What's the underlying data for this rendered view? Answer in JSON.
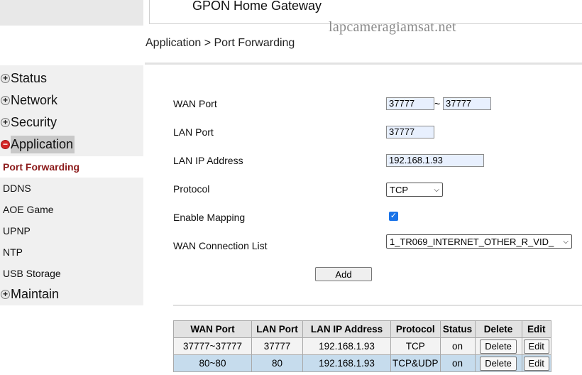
{
  "header": {
    "title": "GPON Home Gateway",
    "watermark": "lapcameragiamsat.net"
  },
  "breadcrumb": "Application > Port Forwarding",
  "sidebar": {
    "groups": [
      {
        "label": "Status",
        "expanded": false
      },
      {
        "label": "Network",
        "expanded": false
      },
      {
        "label": "Security",
        "expanded": false
      },
      {
        "label": "Application",
        "expanded": true
      },
      {
        "label": "Maintain",
        "expanded": false
      }
    ],
    "sub_items": [
      "Port Forwarding",
      "DDNS",
      "AOE Game",
      "UPNP",
      "NTP",
      "USB Storage"
    ],
    "selected": "Port Forwarding"
  },
  "form": {
    "wan_port_label": "WAN Port",
    "wan_port_start": "37777",
    "tilde": "~",
    "wan_port_end": "37777",
    "lan_port_label": "LAN Port",
    "lan_port": "37777",
    "lan_ip_label": "LAN IP Address",
    "lan_ip": "192.168.1.93",
    "protocol_label": "Protocol",
    "protocol": "TCP",
    "enable_mapping_label": "Enable Mapping",
    "enable_mapping": true,
    "wan_conn_label": "WAN Connection List",
    "wan_conn": "1_TR069_INTERNET_OTHER_R_VID_",
    "add_label": "Add"
  },
  "table": {
    "headers": [
      "WAN Port",
      "LAN Port",
      "LAN IP Address",
      "Protocol",
      "Status",
      "Delete",
      "Edit"
    ],
    "rows": [
      {
        "wan_port": "37777~37777",
        "lan_port": "37777",
        "lan_ip": "192.168.1.93",
        "protocol": "TCP",
        "status": "on",
        "delete": "Delete",
        "edit": "Edit"
      },
      {
        "wan_port": "80~80",
        "lan_port": "80",
        "lan_ip": "192.168.1.93",
        "protocol": "TCP&UDP",
        "status": "on",
        "delete": "Delete",
        "edit": "Edit"
      }
    ]
  },
  "colors": {
    "selected_menu_text": "#8b1a1a",
    "highlight_row": "#c6dced",
    "input_bg": "#e8f0fe",
    "checkbox": "#1a73e8"
  }
}
